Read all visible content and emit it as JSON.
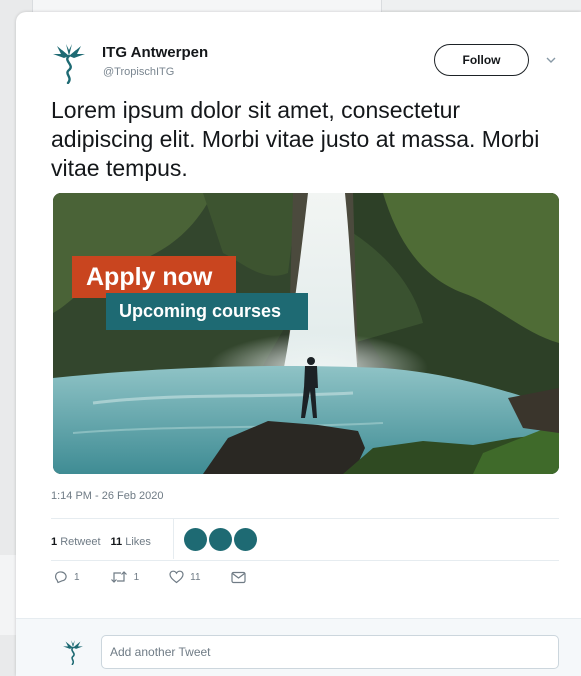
{
  "author": {
    "name": "ITG Antwerpen",
    "handle": "@TropischITG"
  },
  "header": {
    "follow_label": "Follow"
  },
  "tweet": {
    "text": "Lorem ipsum dolor sit amet, consectetur adipiscing elit. Morbi vitae justo at massa. Morbi vitae tempus.",
    "timestamp": "1:14 PM - 26 Feb 2020"
  },
  "media": {
    "apply_label": "Apply now",
    "courses_label": "Upcoming courses"
  },
  "stats": {
    "retweets_count": "1",
    "retweets_label": "Retweet",
    "likes_count": "11",
    "likes_label": "Likes"
  },
  "actions": {
    "reply_count": "1",
    "retweet_count": "1",
    "like_count": "11"
  },
  "reply": {
    "placeholder": "Add another Tweet"
  },
  "colors": {
    "brand_teal": "#1e6a73",
    "apply_orange": "#c9451f"
  },
  "icons": {
    "logo": "itg-palm-logo-icon",
    "caret": "chevron-down-icon",
    "reply": "reply-icon",
    "retweet": "retweet-icon",
    "like": "heart-icon",
    "message": "envelope-icon"
  }
}
